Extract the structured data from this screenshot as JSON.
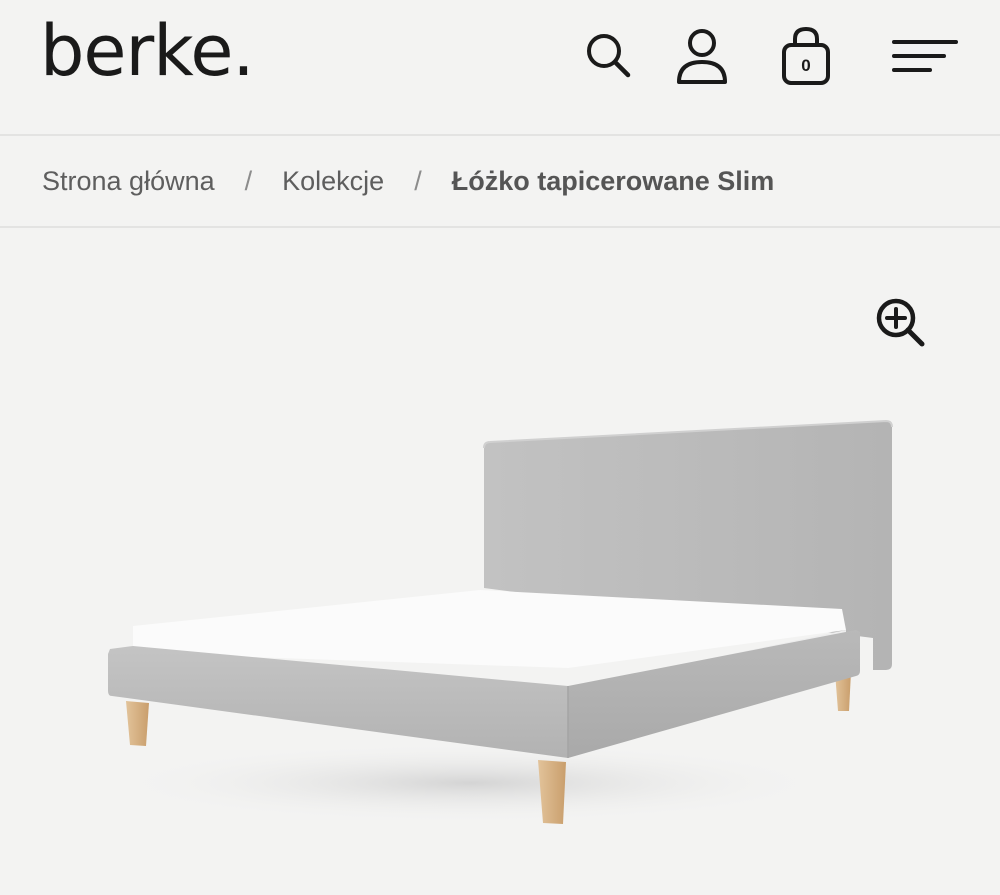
{
  "header": {
    "logo": "berke.",
    "icons": {
      "search": "search-icon",
      "account": "user-icon",
      "cart": "shopping-bag-icon",
      "menu": "hamburger-menu-icon"
    },
    "cart_count": "0"
  },
  "breadcrumb": {
    "items": [
      "Strona główna",
      "Kolekcje"
    ],
    "separator": "/",
    "current": "Łóżko tapicerowane Slim"
  },
  "gallery": {
    "zoom_icon": "zoom-in-icon",
    "image": "upholstered-bed-product-photo"
  },
  "colors": {
    "background": "#f3f3f2",
    "text": "#1a1a1a",
    "breadcrumb_text": "#5e5e5e",
    "fabric": "#bdbdbd",
    "wood_legs": "#d8b487"
  }
}
